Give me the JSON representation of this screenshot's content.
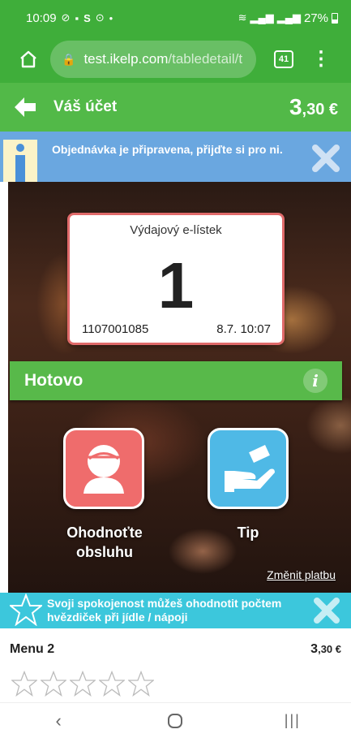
{
  "status_bar": {
    "time": "10:09",
    "battery": "27%",
    "icons": [
      "check-circle-icon",
      "teams-icon",
      "s-icon",
      "pinterest-icon",
      "dot-icon",
      "wifi-icon",
      "signal-lte1-icon",
      "signal-lte2-icon",
      "battery-icon"
    ]
  },
  "browser": {
    "url_host": "test.ikelp.com",
    "url_path": "/tabledetail/t",
    "tab_count": "41"
  },
  "header": {
    "title": "Váš účet",
    "price_main": "3",
    "price_decimals": ",30 €"
  },
  "info_banner": {
    "text": "Objednávka je připravena, přijďte si pro ni."
  },
  "ticket": {
    "title": "Výdajový e-lístek",
    "number": "1",
    "id": "1107001085",
    "time": "8.7. 10:07"
  },
  "status": {
    "label": "Hotovo",
    "info_glyph": "i"
  },
  "actions": {
    "rate_label": "Ohodnoťte obsluhu",
    "tip_label": "Tip",
    "change_payment": "Změnit platbu"
  },
  "rating_banner": {
    "text": "Svoji spokojenost můžeš ohodnotit počtem hvězdiček při jídle / nápoji"
  },
  "item": {
    "name": "Menu 2",
    "price_main": "3",
    "price_decimals": ",30 €",
    "rating": 0,
    "rating_max": 5
  },
  "colors": {
    "brand_green": "#3fae3a",
    "header_green": "#52b948",
    "info_blue": "#6aa7e0",
    "rate_red": "#ef6c6c",
    "tip_blue": "#4fb9e6",
    "rating_cyan": "#3cc7dc"
  }
}
